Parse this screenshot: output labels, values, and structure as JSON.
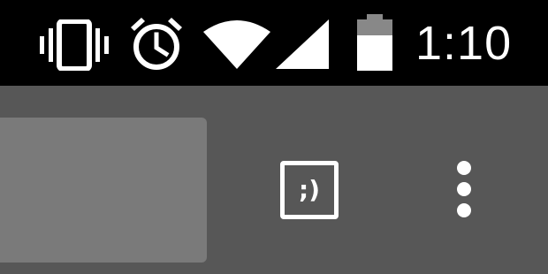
{
  "status_bar": {
    "icons": [
      "vibrate-icon",
      "alarm-icon",
      "wifi-icon",
      "signal-icon",
      "battery-icon"
    ],
    "time": "1:10",
    "background_color": "#000000",
    "icon_color": "#ffffff"
  },
  "toolbar": {
    "background_color": "#575757",
    "search_box_color": "#7a7a7a",
    "emoji_button_label": ";)",
    "overflow_icon": "more-vert-icon"
  }
}
